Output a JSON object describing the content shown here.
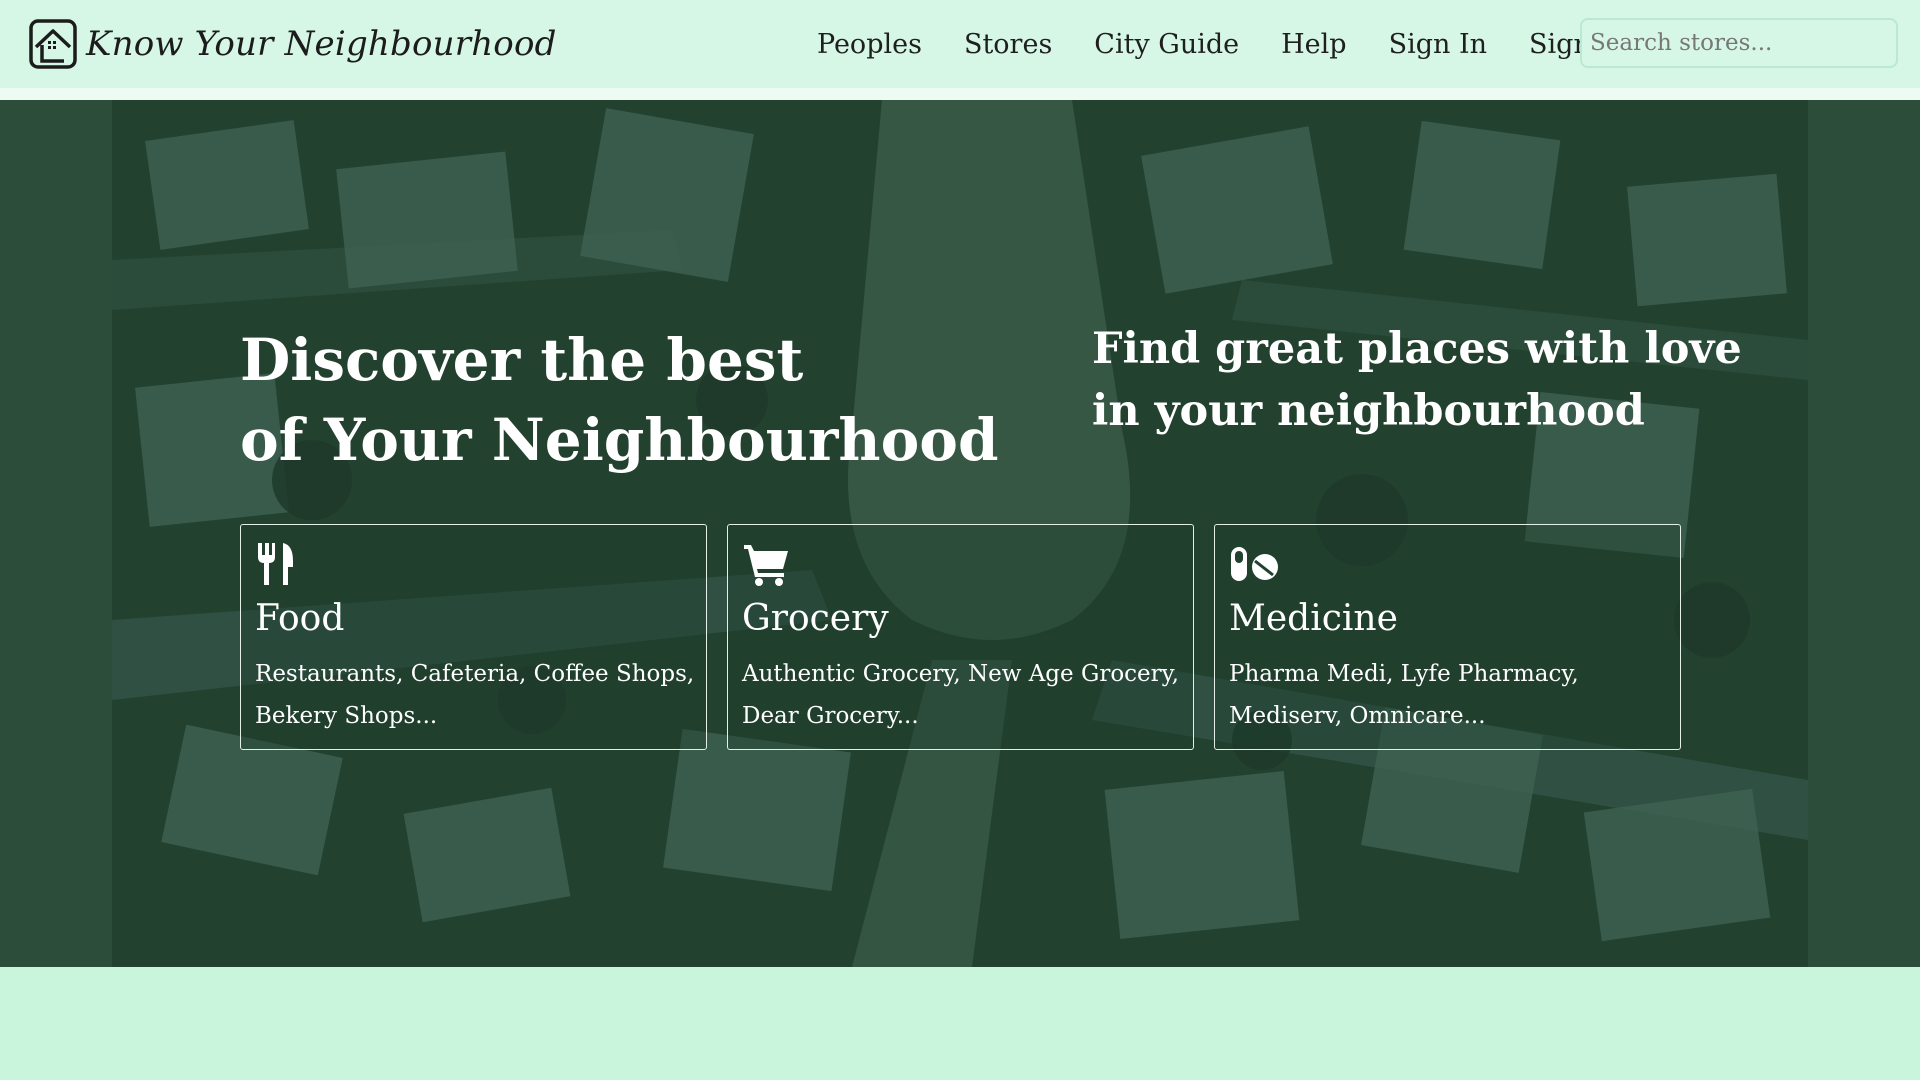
{
  "brand": {
    "name": "Know Your Neighbourhood",
    "logo_icon": "house-outline-icon"
  },
  "nav": {
    "links": [
      "Peoples",
      "Stores",
      "City Guide",
      "Help",
      "Sign In",
      "Sign Up"
    ],
    "search_placeholder": "Search stores..."
  },
  "hero": {
    "title_line1": "Discover the best",
    "title_line2": "of Your Neighbourhood",
    "tagline_line1": "Find great places with love",
    "tagline_line2": "in your neighbourhood"
  },
  "categories": [
    {
      "icon": "fork-knife-icon",
      "title": "Food",
      "desc_line1": "Restaurants, Cafeteria, Coffee Shops,",
      "desc_line2": "Bekery Shops..."
    },
    {
      "icon": "shopping-cart-icon",
      "title": "Grocery",
      "desc_line1": "Authentic Grocery, New Age Grocery,",
      "desc_line2": "Dear Grocery..."
    },
    {
      "icon": "pills-icon",
      "title": "Medicine",
      "desc_line1": "Pharma Medi, Lyfe Pharmacy,",
      "desc_line2": "Mediserv, Omnicare..."
    }
  ],
  "colors": {
    "header_bg": "#d6f7e6",
    "hero_overlay": "#23412f",
    "footer_bg": "#c9f5dc",
    "text_light": "#ffffff"
  }
}
